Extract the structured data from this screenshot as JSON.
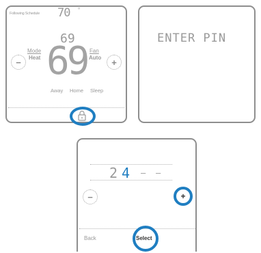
{
  "screen1": {
    "status": "Following Schedule",
    "outdoor_temp": "70",
    "outdoor_unit": "°",
    "setpoint": "69",
    "current_temp": "69",
    "mode_label": "Mode",
    "mode_value": "Heat",
    "fan_label": "Fan",
    "fan_value": "Auto",
    "minus": "−",
    "plus": "+",
    "options": [
      "Away",
      "Home",
      "Sleep"
    ]
  },
  "screen2": {
    "prompt": "ENTER PIN"
  },
  "screen3": {
    "pin_digits": [
      "2",
      "4",
      "–",
      "–"
    ],
    "minus": "−",
    "plus": "+",
    "back_label": "Back",
    "select_label": "Select"
  },
  "colors": {
    "highlight": "#1f7ec1",
    "pin_active": "#1f7ec1",
    "frame": "#8e8e8e"
  }
}
